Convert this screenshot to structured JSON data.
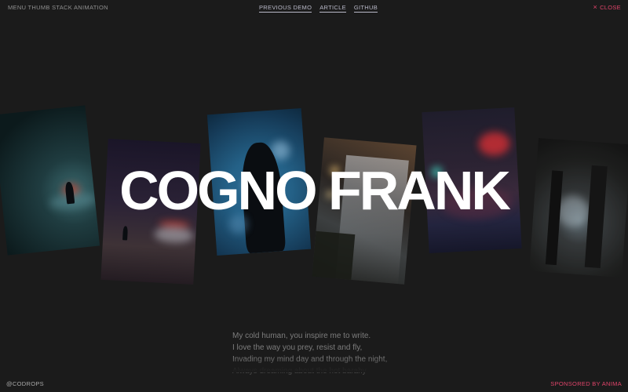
{
  "header": {
    "title": "MENU THUMB STACK ANIMATION",
    "nav": [
      {
        "label": "PREVIOUS DEMO"
      },
      {
        "label": "ARTICLE"
      },
      {
        "label": "GITHUB"
      }
    ],
    "close_label": "CLOSE",
    "close_icon": "close-icon"
  },
  "main": {
    "title_words": [
      "COGNO",
      "FRANK"
    ],
    "poem_lines": [
      "My cold human, you inspire me to write.",
      "I love the way you prey, resist and fly,",
      "Invading my mind day and through the night,",
      "Always dreaming about the hot barahy"
    ]
  },
  "footer": {
    "credit": "@CODROPS",
    "sponsor": "SPONSORED BY ANIMA"
  },
  "colors": {
    "background": "#1b1b1b",
    "accent": "#e0446a",
    "title": "#ffffff"
  }
}
